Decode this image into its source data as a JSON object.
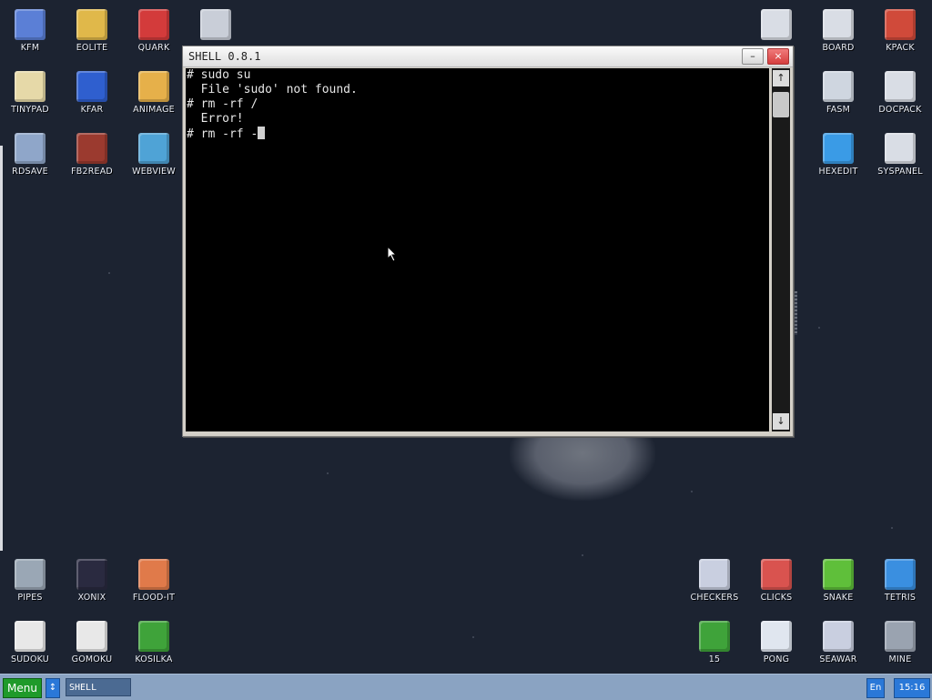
{
  "desktop_icons_top_left": [
    {
      "label": "KFM",
      "icon": "floppy-disk-icon",
      "color": "#5b7fd6"
    },
    {
      "label": "EOLITE",
      "icon": "folder-icon",
      "color": "#e0b84a"
    },
    {
      "label": "QUARK",
      "icon": "notebook-icon",
      "color": "#d33b3b"
    },
    {
      "label": "",
      "icon": "calculator-icon",
      "color": "#c9ced8"
    },
    {
      "label": "TINYPAD",
      "icon": "notepad-pencil-icon",
      "color": "#e6d9a8"
    },
    {
      "label": "KFAR",
      "icon": "dual-panel-icon",
      "color": "#2f5fcf"
    },
    {
      "label": "ANIMAGE",
      "icon": "pencil-ruler-icon",
      "color": "#e6b04a"
    },
    {
      "label": "RDSAVE",
      "icon": "ram-disk-icon",
      "color": "#8fa6c9"
    },
    {
      "label": "FB2READ",
      "icon": "book-icon",
      "color": "#9b3a2f"
    },
    {
      "label": "WEBVIEW",
      "icon": "globe-window-icon",
      "color": "#4fa3d6"
    }
  ],
  "desktop_icons_top_right": [
    {
      "label": "",
      "icon": "bug-window-icon",
      "color": "#d9dde5"
    },
    {
      "label": "BOARD",
      "icon": "clipboard-icon",
      "color": "#d9dde5"
    },
    {
      "label": "KPACK",
      "icon": "hammer-icon",
      "color": "#d04a3a"
    },
    {
      "label": "FASM",
      "icon": "fasm-icon",
      "color": "#cfd6e0"
    },
    {
      "label": "DOCPACK",
      "icon": "cabinet-icon",
      "color": "#d9dde5"
    },
    {
      "label": "HEXEDIT",
      "icon": "he-letters-icon",
      "color": "#3a9be6"
    },
    {
      "label": "SYSPANEL",
      "icon": "sliders-icon",
      "color": "#d9dde5"
    }
  ],
  "desktop_icons_bottom_left": [
    {
      "label": "PIPES",
      "icon": "pipes-icon",
      "color": "#9aa7b5"
    },
    {
      "label": "XONIX",
      "icon": "xonix-icon",
      "color": "#2a2a40"
    },
    {
      "label": "FLOOD-IT",
      "icon": "color-grid-icon",
      "color": "#e07a4a"
    },
    {
      "label": "SUDOKU",
      "icon": "sudoku-grid-icon",
      "color": "#e8e8e8"
    },
    {
      "label": "GOMOKU",
      "icon": "xo-grid-icon",
      "color": "#e8e8e8"
    },
    {
      "label": "KOSILKA",
      "icon": "lawnmower-icon",
      "color": "#3fa33a"
    }
  ],
  "desktop_icons_bottom_right": [
    {
      "label": "CHECKERS",
      "icon": "checkers-pieces-icon",
      "color": "#c9cfe0"
    },
    {
      "label": "CLICKS",
      "icon": "blocks-icon",
      "color": "#d9534f"
    },
    {
      "label": "SNAKE",
      "icon": "snake-icon",
      "color": "#5fbf3a"
    },
    {
      "label": "TETRIS",
      "icon": "tetris-cube-icon",
      "color": "#3a8fe0"
    },
    {
      "label": "15",
      "icon": "fifteen-grid-icon",
      "color": "#3fa33a"
    },
    {
      "label": "PONG",
      "icon": "pong-icon",
      "color": "#e0e6ef"
    },
    {
      "label": "SEAWAR",
      "icon": "sailing-ship-icon",
      "color": "#c9cfe0"
    },
    {
      "label": "MINE",
      "icon": "mine-icon",
      "color": "#9aa3b0"
    }
  ],
  "window": {
    "title": "SHELL 0.8.1",
    "minimize_label": "–",
    "close_label": "×",
    "terminal_lines": [
      "# sudo su",
      "  File 'sudo' not found.",
      "# rm -rf /",
      "  Error!",
      "# rm -rf -"
    ],
    "scroll_up_label": "↑",
    "scroll_down_label": "↓"
  },
  "taskbar": {
    "menu_label": "Menu",
    "switch_label": "↕",
    "task_item_label": "SHELL",
    "language_label": "En",
    "clock": "15:16",
    "menu_color": "#1f9a2a",
    "bar_color": "#8aa3c2"
  }
}
